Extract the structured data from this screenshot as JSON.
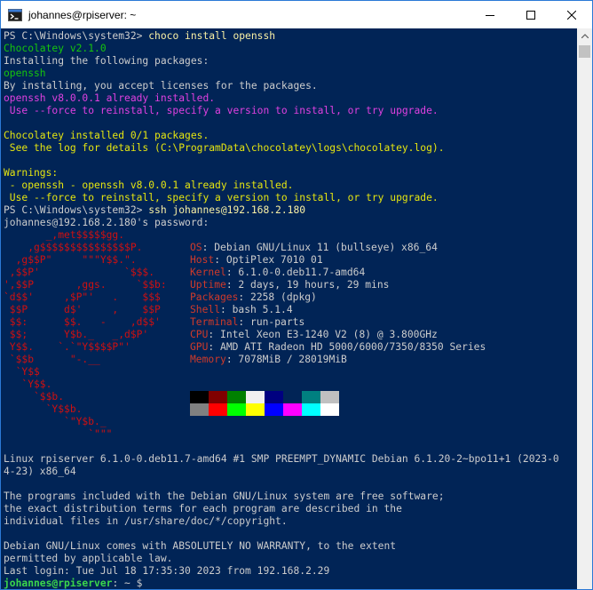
{
  "window": {
    "title": "johannes@rpiserver: ~"
  },
  "colors": {
    "terminal_bg": "#012456",
    "titlebar_bg": "#ffffff",
    "accent_border": "#2b79d6",
    "prompt_green": "#16c60c",
    "warning_yellow": "#f9f1a5",
    "error_magenta": "#e040e0",
    "debian_red": "#d01010"
  },
  "icons": {
    "app": "terminal-icon",
    "minimize": "minimize-icon",
    "maximize": "maximize-icon",
    "close": "close-icon",
    "scroll_up": "chevron-up-icon"
  },
  "terminal": {
    "ps_block": [
      {
        "text": "PS C:\\Windows\\system32> ",
        "cls": "w",
        "cont": [
          {
            "text": "choco install openssh",
            "cls": "y"
          }
        ]
      },
      {
        "text": "Chocolatey v2.1.0",
        "cls": "g"
      },
      {
        "text": "Installing the following packages:",
        "cls": "w"
      },
      {
        "text": "openssh",
        "cls": "g"
      },
      {
        "text": "By installing, you accept licenses for the packages.",
        "cls": "w"
      },
      {
        "text": "openssh v8.0.0.1 already installed.",
        "cls": "m"
      },
      {
        "text": " Use --force to reinstall, specify a version to install, or try upgrade.",
        "cls": "m"
      },
      {
        "text": "",
        "cls": "w"
      },
      {
        "text": "Chocolatey installed 0/1 packages.",
        "cls": "yy"
      },
      {
        "text": " See the log for details (C:\\ProgramData\\chocolatey\\logs\\chocolatey.log).",
        "cls": "yy"
      },
      {
        "text": "",
        "cls": "w"
      },
      {
        "text": "Warnings:",
        "cls": "yy"
      },
      {
        "text": " - openssh - openssh v8.0.0.1 already installed.",
        "cls": "yy"
      },
      {
        "text": " Use --force to reinstall, specify a version to install, or try upgrade.",
        "cls": "yy"
      },
      {
        "text": "PS C:\\Windows\\system32> ",
        "cls": "w",
        "cont": [
          {
            "text": "ssh johannes@192.168.2.180",
            "cls": "y"
          }
        ]
      },
      {
        "text": "johannes@192.168.2.180's password:",
        "cls": "w"
      }
    ],
    "neofetch": [
      {
        "art": "       _,met$$$$$gg.",
        "label": "",
        "value": ""
      },
      {
        "art": "    ,g$$$$$$$$$$$$$$$P.",
        "label": "OS",
        "value": "Debian GNU/Linux 11 (bullseye) x86_64"
      },
      {
        "art": "  ,g$$P\"     \"\"\"Y$$.\".",
        "label": "Host",
        "value": "OptiPlex 7010 01"
      },
      {
        "art": " ,$$P'              `$$$.",
        "label": "Kernel",
        "value": "6.1.0-0.deb11.7-amd64"
      },
      {
        "art": "',$$P       ,ggs.     `$$b:",
        "label": "Uptime",
        "value": "2 days, 19 hours, 29 mins"
      },
      {
        "art": "`d$$'     ,$P\"'   .    $$$",
        "label": "Packages",
        "value": "2258 (dpkg)"
      },
      {
        "art": " $$P      d$'     ,    $$P",
        "label": "Shell",
        "value": "bash 5.1.4"
      },
      {
        "art": " $$:      $$.   -    ,d$$'",
        "label": "Terminal",
        "value": "run-parts"
      },
      {
        "art": " $$;      Y$b._   _,d$P'",
        "label": "CPU",
        "value": "Intel Xeon E3-1240 V2 (8) @ 3.800GHz"
      },
      {
        "art": " Y$$.    `.`\"Y$$$$P\"'",
        "label": "GPU",
        "value": "AMD ATI Radeon HD 5000/6000/7350/8350 Series"
      },
      {
        "art": " `$$b      \"-.__",
        "label": "Memory",
        "value": "7078MiB / 28019MiB"
      },
      {
        "art": "  `Y$$",
        "label": "",
        "value": ""
      },
      {
        "art": "   `Y$$.",
        "label": "",
        "value": ""
      },
      {
        "art": "     `$$b.",
        "label": "",
        "value": ""
      },
      {
        "art": "       `Y$$b.",
        "label": "",
        "value": ""
      },
      {
        "art": "          `\"Y$b._",
        "label": "",
        "value": ""
      },
      {
        "art": "              `\"\"\"",
        "label": "",
        "value": ""
      }
    ],
    "palette_top": [
      "#000000",
      "#800000",
      "#008000",
      "#f0f0f0",
      "#000080",
      "#012456",
      "#008080",
      "#c0c0c0"
    ],
    "palette_bottom": [
      "#808080",
      "#ff0000",
      "#00ff00",
      "#ffff00",
      "#0000ff",
      "#ff00ff",
      "#00ffff",
      "#ffffff"
    ],
    "motd": [
      "",
      "Linux rpiserver 6.1.0-0.deb11.7-amd64 #1 SMP PREEMPT_DYNAMIC Debian 6.1.20-2~bpo11+1 (2023-0",
      "4-23) x86_64",
      "",
      "The programs included with the Debian GNU/Linux system are free software;",
      "the exact distribution terms for each program are described in the",
      "individual files in /usr/share/doc/*/copyright.",
      "",
      "Debian GNU/Linux comes with ABSOLUTELY NO WARRANTY, to the extent",
      "permitted by applicable law.",
      "Last login: Tue Jul 18 17:35:30 2023 from 192.168.2.29"
    ],
    "final_prompt": {
      "user_host": "johannes@rpiserver",
      "rest": ": ~ $"
    }
  }
}
